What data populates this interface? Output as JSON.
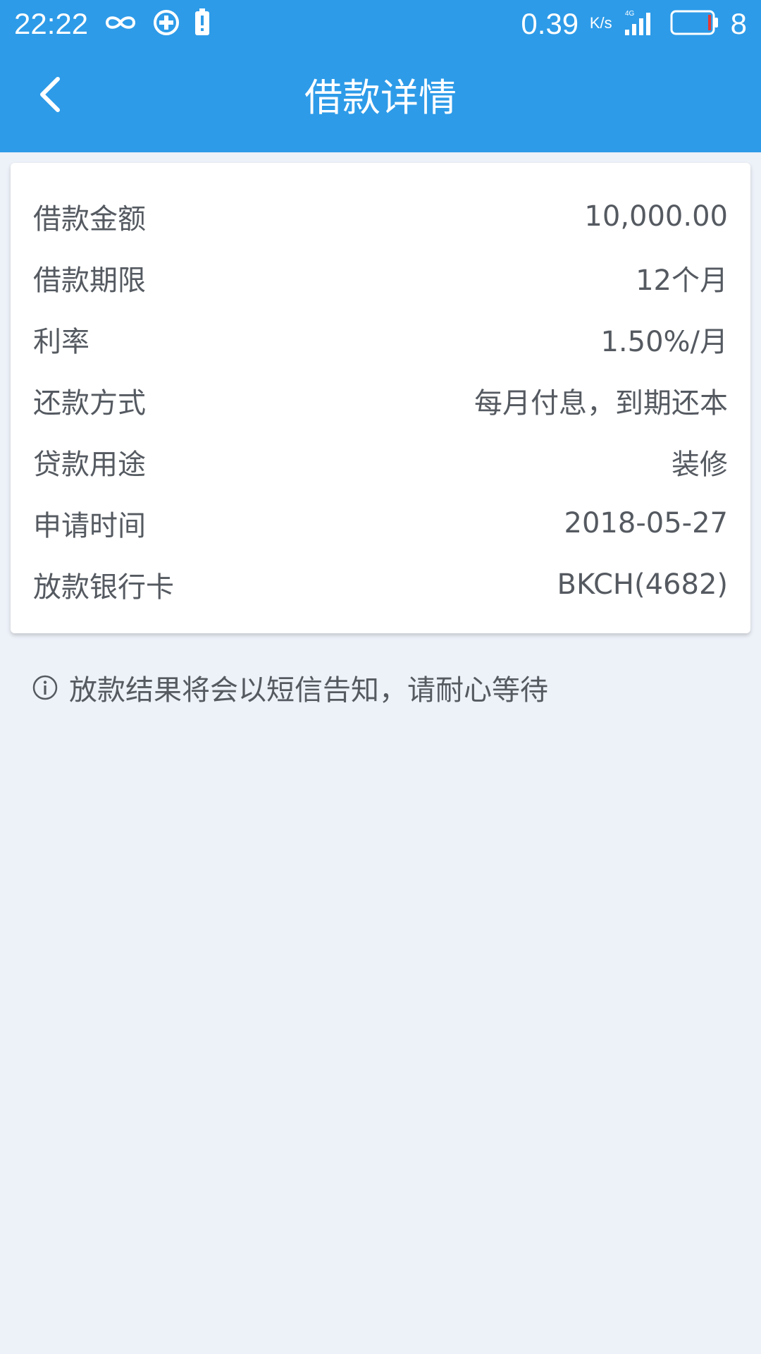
{
  "status_bar": {
    "time": "22:22",
    "net_speed": "0.39",
    "net_unit": "K/s",
    "network_type": "4G",
    "battery_level": "8",
    "icons": [
      "infinity-icon",
      "sync-icon",
      "battery-alert-icon",
      "signal-icon",
      "battery-icon"
    ]
  },
  "navbar": {
    "title": "借款详情",
    "back_icon": "chevron-left-icon"
  },
  "details": {
    "rows": [
      {
        "label": "借款金额",
        "value": "10,000.00"
      },
      {
        "label": "借款期限",
        "value": "12个月"
      },
      {
        "label": "利率",
        "value": "1.50%/月"
      },
      {
        "label": "还款方式",
        "value": "每月付息，到期还本"
      },
      {
        "label": "贷款用途",
        "value": "装修"
      },
      {
        "label": "申请时间",
        "value": "2018-05-27"
      },
      {
        "label": "放款银行卡",
        "value": "BKCH(4682)"
      }
    ]
  },
  "notice": {
    "icon": "info-icon",
    "text": "放款结果将会以短信告知，请耐心等待"
  },
  "colors": {
    "header": "#2d9be8",
    "background": "#edf1f8",
    "text": "#555a61",
    "battery_warning": "#e53935"
  }
}
